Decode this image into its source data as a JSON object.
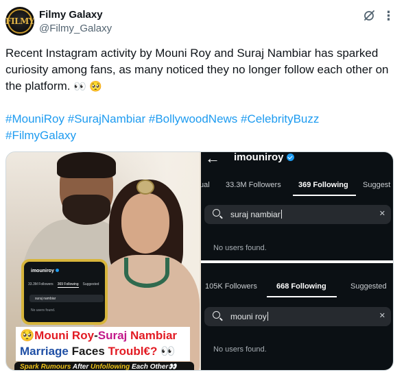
{
  "author": {
    "name": "Filmy Galaxy",
    "handle": "@Filmy_Galaxy",
    "avatar_text": "FILMY"
  },
  "tweet": {
    "text": "Recent Instagram activity by Mouni Roy and Suraj Nambiar has sparked curiosity among fans, as many noticed they no longer follow each other on the platform.",
    "emojis": "👀 🥺",
    "hashtags": [
      "#MouniRoy",
      "#SurajNambiar",
      "#BollywoodNews",
      "#CelebrityBuzz",
      "#FilmyGalaxy"
    ]
  },
  "icons": {
    "grok": "grok-icon",
    "more": "more-icon",
    "back": "back-arrow-icon",
    "search": "search-icon",
    "clear": "close-icon",
    "verified": "verified-icon"
  },
  "media": {
    "thumbnail_card": {
      "username": "imouniroy",
      "tab_followers": "33.3M Followers",
      "tab_following": "369 Following",
      "tab_suggested": "Suggested",
      "search_value": "suraj nambiar",
      "no_results": "No users found."
    },
    "headline": {
      "emoji": "🥺",
      "part1": "Mouni Roy",
      "dash": "-",
      "part2": "Suraj",
      "part3": "Nambiar",
      "line2_word1": "Marriage",
      "line2_word2": "Faces",
      "line2_word3": "Troubl€?",
      "line2_emoji": "👀"
    },
    "tagline": {
      "w1": "Spark Rumours",
      "w2": "After",
      "w3": "Unfollowing",
      "w4": "Each Other",
      "emoji": "👀"
    },
    "screenshot_top": {
      "username": "imouniroy",
      "tab_partial": "ual",
      "tab_followers": "33.3M Followers",
      "tab_following": "369 Following",
      "tab_suggested": "Suggest",
      "search_value": "suraj nambiar",
      "no_results": "No users found."
    },
    "screenshot_bottom": {
      "tab_followers": "105K Followers",
      "tab_following": "668 Following",
      "tab_suggested": "Suggested",
      "search_value": "mouni roy",
      "no_results": "No users found."
    }
  },
  "colors": {
    "link": "#1d9bf0",
    "headline_red": "#e21b23",
    "headline_pink": "#c2188a",
    "headline_blue": "#1f4fa5",
    "tagline_yellow": "#f0c419"
  }
}
